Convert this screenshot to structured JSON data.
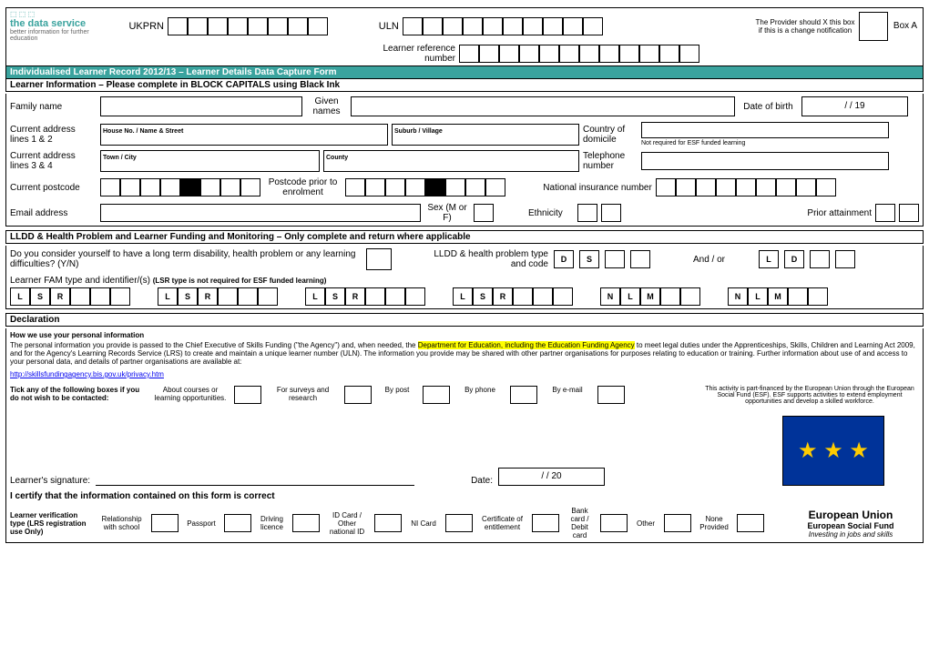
{
  "top": {
    "ukprn": "UKPRN",
    "uln": "ULN",
    "lref": "Learner reference number",
    "provider": "The Provider should X this box if this is a change notification",
    "boxA": "Box A",
    "logo1": "the data service",
    "logo2": "better information for further education"
  },
  "titles": {
    "main": "Individualised Learner Record 2012/13  –  Learner Details Data Capture Form",
    "learner": "Learner Information – Please complete in BLOCK CAPITALS using Black Ink",
    "lldd": "LLDD & Health Problem and Learner Funding and Monitoring – Only complete and return where applicable",
    "decl": "Declaration"
  },
  "li": {
    "family": "Family name",
    "given": "Given names",
    "dob": "Date of birth",
    "dobfmt": "/            / 19",
    "addr12": "Current address lines 1 & 2",
    "addr12a": "House No. / Name & Street",
    "addr12b": "Suburb / Village",
    "domicile": "Country of domicile",
    "domnote": "Not required for ESF funded learning",
    "addr34": "Current address lines 3 & 4",
    "addr34a": "Town / City",
    "addr34b": "County",
    "tel": "Telephone number",
    "cpc": "Current postcode",
    "ppc": "Postcode prior to enrolment",
    "nino": "National insurance number",
    "email": "Email address",
    "sex": "Sex (M or F)",
    "eth": "Ethnicity",
    "prior": "Prior attainment"
  },
  "lldd": {
    "q": "Do you consider yourself to have a long term disability, health problem or any learning difficulties? (Y/N)",
    "type": "LLDD & health problem type and code",
    "D": "D",
    "S": "S",
    "andor": "And / or",
    "L": "L",
    "D2": "D",
    "fam": "Learner FAM type and identifier/(s)",
    "famnote": "(LSR type is not required for ESF funded learning)",
    "R": "R",
    "N": "N",
    "M": "M"
  },
  "decl": {
    "how": "How we use your personal information",
    "para": "The personal information you provide is passed to the Chief Executive of Skills Funding (\"the Agency\") and, when needed, the ",
    "hl": "Department for Education, including the Education Funding Agency",
    "para2": " to meet legal duties under the Apprenticeships, Skills, Children and Learning Act 2009, and for the Agency's Learning Records Service (LRS) to create and maintain a unique learner number (ULN). The information you provide may be shared with other partner organisations for purposes relating to education or training.  Further information about use of and access to your personal data, and details of partner organisations are available at:",
    "link": "http://skillsfundingagency.bis.gov.uk/privacy.htm",
    "tick": "Tick any of the following boxes if you do not wish to be contacted:",
    "opt1": "About courses or learning opportunities.",
    "opt2": "For surveys and research",
    "opt3": "By post",
    "opt4": "By phone",
    "opt5": "By e-mail",
    "esf": "This activity is part-financed by the European Union through the European Social Fund (ESF). ESF supports activities to extend employment opportunities and develop a skilled workforce.",
    "sig": "Learner's signature:",
    "date": "Date:",
    "datefmt": "/            / 20",
    "cert": "I certify that the information contained on this form is correct",
    "lv": "Learner verification type (LRS registration use Only)",
    "v1": "Relationship with school",
    "v2": "Passport",
    "v3": "Driving licence",
    "v4": "ID Card / Other national ID",
    "v5": "NI Card",
    "v6": "Certificate of entitlement",
    "v7": "Bank card / Debit card",
    "v8": "Other",
    "v9": "None Provided",
    "eu1": "European Union",
    "eu2": "European Social Fund",
    "eu3": "Investing in jobs and skills"
  }
}
